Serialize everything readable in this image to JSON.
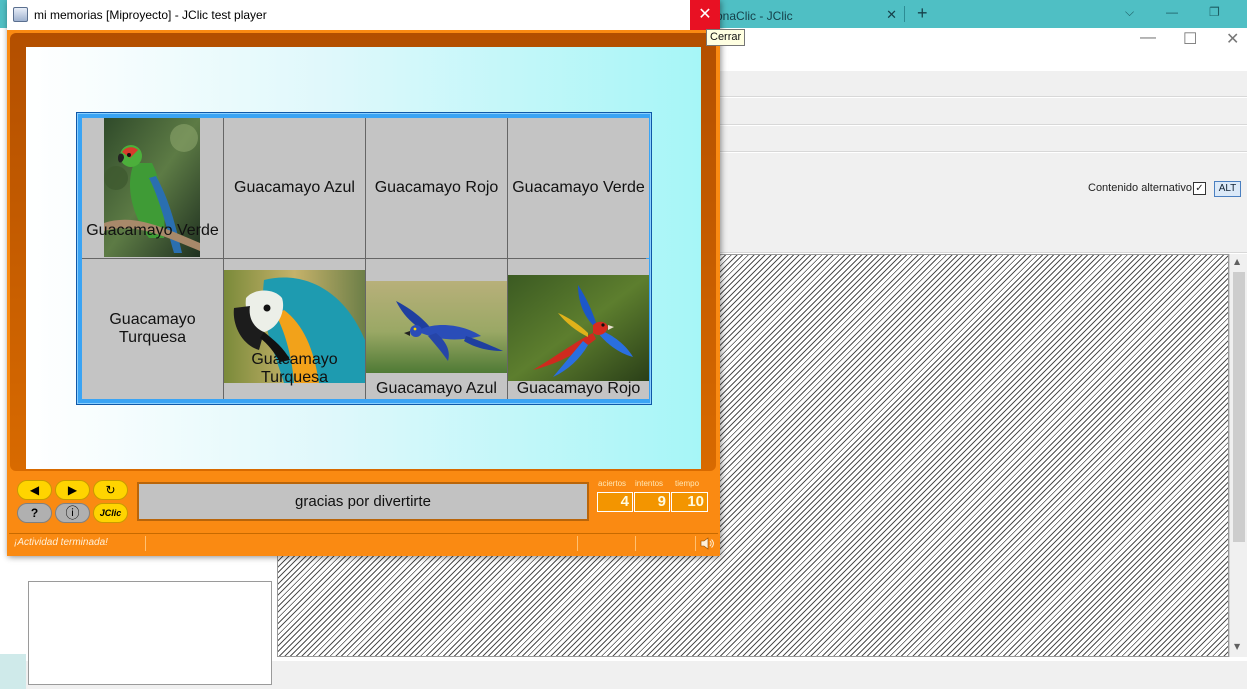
{
  "background_app": {
    "tab_title": "onaClic - JClic",
    "tab_close": "✕",
    "new_tab": "+",
    "tabbar_controls": [
      "⌵",
      "—",
      "❐"
    ],
    "window_controls": [
      "—",
      "☐",
      "✕"
    ],
    "alt_content_label": "Contenido alternativo:",
    "alt_checkbox": "✓",
    "alt_button": "ALT"
  },
  "tooltip": {
    "text": "Cerrar"
  },
  "player": {
    "title": "mi memorias [Miproyecto] - JClic test player",
    "close_glyph": "✕",
    "cards": [
      {
        "type": "image",
        "image": "green-macaw",
        "caption": "Guacamayo Verde"
      },
      {
        "type": "text",
        "text": "Guacamayo Azul"
      },
      {
        "type": "text",
        "text": "Guacamayo Rojo"
      },
      {
        "type": "text",
        "text": "Guacamayo Verde"
      },
      {
        "type": "text",
        "text": "Guacamayo Turquesa"
      },
      {
        "type": "image",
        "image": "turquoise-macaw",
        "caption": "Guacamayo Turquesa"
      },
      {
        "type": "image",
        "image": "blue-macaw",
        "caption": "Guacamayo Azul"
      },
      {
        "type": "image",
        "image": "red-macaw",
        "caption": "Guacamayo Rojo"
      }
    ],
    "buttons": {
      "prev": "◀",
      "next": "▶",
      "reset": "↻",
      "help": "?",
      "info": "ⓘ",
      "about": "JClic"
    },
    "message": "gracias por divertirte",
    "counters": [
      {
        "label": "aciertos",
        "value": "4"
      },
      {
        "label": "intentos",
        "value": "9"
      },
      {
        "label": "tiempo",
        "value": "10"
      }
    ],
    "status": "¡Actividad terminada!"
  },
  "colors": {
    "frame_orange": "#fa8a12",
    "button_yellow": "#ffd400",
    "board_blue": "#3aa4f4",
    "close_red": "#e81123"
  }
}
